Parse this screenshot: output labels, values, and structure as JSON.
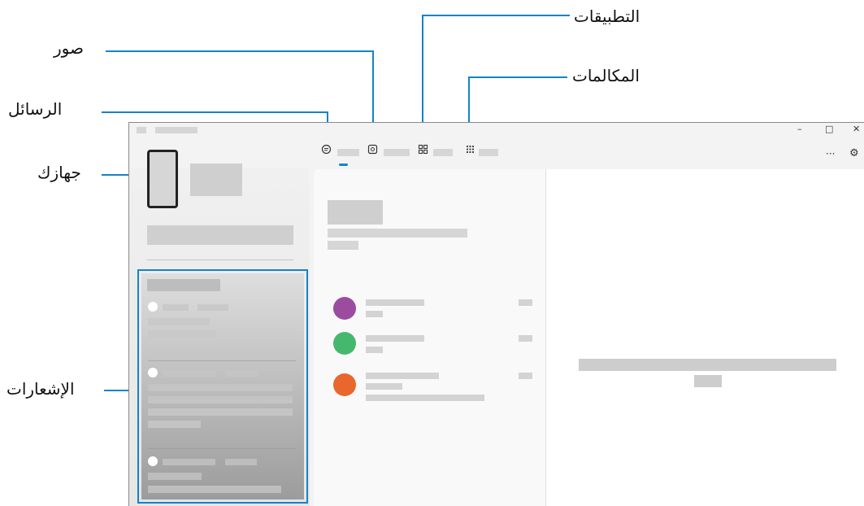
{
  "callouts": {
    "apps": "التطبيقات",
    "photos": "صور",
    "calls": "المكالمات",
    "messages": "الرسائل",
    "device": "جهازك",
    "notifications": "الإشعارات"
  },
  "window_controls": {
    "minimize": "–",
    "maximize": "□",
    "close": "✕",
    "more": "···",
    "settings": "⚙"
  },
  "contacts": [
    {
      "avatar_color": "#9b4c9f"
    },
    {
      "avatar_color": "#46b86e"
    },
    {
      "avatar_color": "#e9662d"
    }
  ],
  "colors": {
    "callout_line": "#1583c8",
    "tab_active": "#1583c8"
  }
}
